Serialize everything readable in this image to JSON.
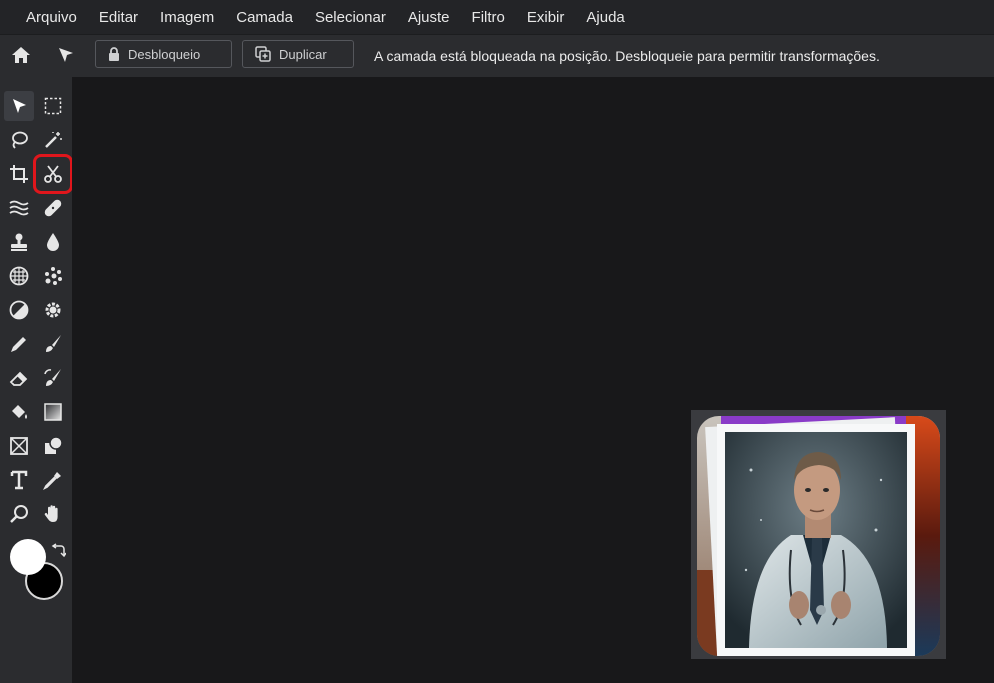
{
  "menu": [
    "Arquivo",
    "Editar",
    "Imagem",
    "Camada",
    "Selecionar",
    "Ajuste",
    "Filtro",
    "Exibir",
    "Ajuda"
  ],
  "toolbar": {
    "unlock_label": "Desbloqueio",
    "duplicate_label": "Duplicar",
    "message": "A camada está bloqueada na posição. Desbloqueie para permitir transformações."
  },
  "tools": [
    "move-tool",
    "marquee-tool",
    "lasso-tool",
    "magic-wand-tool",
    "crop-tool",
    "cut-tool",
    "liquify-tool",
    "healing-tool",
    "clone-stamp-tool",
    "blur-tool",
    "pattern-tool",
    "spot-tool",
    "dodge-tool",
    "sponge-tool",
    "pencil-tool",
    "brush-tool",
    "eraser-tool",
    "color-replace-tool",
    "paint-bucket-tool",
    "gradient-tool",
    "frame-tool",
    "shape-tool",
    "text-tool",
    "eyedropper-tool",
    "zoom-tool",
    "hand-tool"
  ],
  "colors": {
    "foreground": "#ffffff",
    "background": "#000000",
    "highlight": "#e0161c"
  }
}
